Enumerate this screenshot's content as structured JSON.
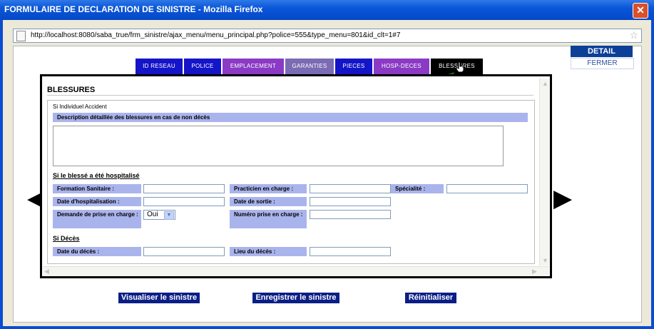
{
  "window": {
    "title": "FORMULAIRE DE DECLARATION DE SINISTRE - Mozilla Firefox"
  },
  "browser": {
    "url": "http://localhost:8080/saba_true/frm_sinistre/ajax_menu/menu_principal.php?police=555&type_menu=801&id_clt=1#7"
  },
  "sidemenu": {
    "detail_label": "DETAIL COMPTE",
    "close_label": "FERMER"
  },
  "tabs": [
    {
      "label": "ID RESEAU"
    },
    {
      "label": "POLICE"
    },
    {
      "label": "EMPLACEMENT"
    },
    {
      "label": "GARANTIES"
    },
    {
      "label": "PIECES"
    },
    {
      "label": "HOSP-DECES"
    },
    {
      "label": "BLESSURES",
      "active": true
    }
  ],
  "colors": {
    "tab_blue": "#1414c8",
    "tab_purple": "#8a3ac4",
    "tab_gray": "#7a6bb4",
    "active_tab": "#000000",
    "label_bg": "#aab4ec",
    "button_bg": "#0b1e86"
  },
  "form": {
    "heading": "BLESSURES",
    "fieldset_legend": "Si Individuel Accident",
    "description_label": "Description détaillée des blessures en cas de non décès",
    "hospital_section": "Si le blessé a été hospitalisé",
    "formation_label": "Formation Sanitaire :",
    "practicien_label": "Practicien en charge :",
    "specialite_label": "Spécialité :",
    "date_hosp_label": "Date d'hospitalisation :",
    "date_sortie_label": "Date de sortie :",
    "demande_label": "Demande de prise en charge :",
    "demande_value": "Oui",
    "numero_label": "Numéro prise en charge :",
    "deces_section": "Si Décès",
    "date_deces_label": "Date du décès :",
    "lieu_deces_label": "Lieu du décès :"
  },
  "actions": {
    "visualiser": "Visualiser le sinistre",
    "enregistrer": "Enregistrer le sinistre",
    "reinitialiser": "Réinitialiser"
  },
  "icons": [
    "close-icon",
    "page-icon",
    "star-icon",
    "chevron-down-icon",
    "green-arrow-icon",
    "hand-cursor-icon",
    "left-nav-arrow-icon",
    "right-nav-arrow-icon"
  ]
}
